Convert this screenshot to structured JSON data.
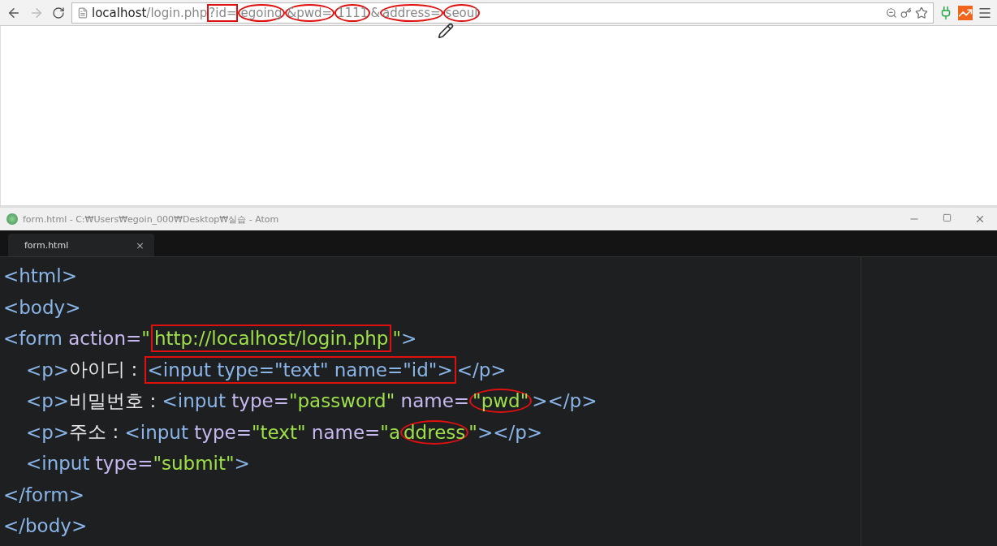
{
  "browser": {
    "url": [
      {
        "text": "localhost",
        "kind": "host"
      },
      {
        "text": "/login.php",
        "kind": "path"
      },
      {
        "text": "?id=",
        "kind": "path",
        "boxed": true
      },
      {
        "text": "egoing",
        "kind": "path",
        "circled": true
      },
      {
        "text": "&pwd=",
        "kind": "path",
        "circled": true
      },
      {
        "text": "1111",
        "kind": "path",
        "circled": true
      },
      {
        "text": "&",
        "kind": "path"
      },
      {
        "text": "address=",
        "kind": "path",
        "circled": true
      },
      {
        "text": "seoul",
        "kind": "path",
        "circled": true
      }
    ]
  },
  "editor": {
    "title": "form.html - C:₩Users₩egoin_000₩Desktop₩실습 - Atom",
    "tabs": [
      {
        "label": "form.html",
        "selected": true,
        "close": "×"
      }
    ],
    "lines": [
      {
        "indent": false,
        "tokens": [
          {
            "kind": "tag",
            "text": "<html>"
          }
        ]
      },
      {
        "indent": false,
        "tokens": [
          {
            "kind": "tag",
            "text": "<body>"
          }
        ]
      },
      {
        "indent": false,
        "tokens": [
          {
            "kind": "tag",
            "text": "<form"
          },
          {
            "kind": "attr",
            "text": " action="
          },
          {
            "kind": "string",
            "text": "\""
          },
          {
            "kind": "string",
            "text": "http://localhost/login.php",
            "boxed": true
          },
          {
            "kind": "string",
            "text": "\""
          },
          {
            "kind": "tag",
            "text": ">"
          }
        ]
      },
      {
        "indent": true,
        "tokens": [
          {
            "kind": "tag",
            "text": "<p>"
          },
          {
            "kind": "text",
            "text": "아이디 : "
          },
          {
            "kind": "tag",
            "text": "<input type=\"text\" name=\"id\">",
            "boxed": true
          },
          {
            "kind": "tag",
            "text": "</p>"
          }
        ]
      },
      {
        "indent": true,
        "tokens": [
          {
            "kind": "tag",
            "text": "<p>"
          },
          {
            "kind": "text",
            "text": "비밀번호 : "
          },
          {
            "kind": "tag",
            "text": "<input"
          },
          {
            "kind": "attr",
            "text": " type="
          },
          {
            "kind": "string",
            "text": "\"password\""
          },
          {
            "kind": "attr",
            "text": " name="
          },
          {
            "kind": "string",
            "text": "\"pwd\"",
            "circled": true
          },
          {
            "kind": "tag",
            "text": "></p>"
          }
        ]
      },
      {
        "indent": true,
        "tokens": [
          {
            "kind": "tag",
            "text": "<p>"
          },
          {
            "kind": "text",
            "text": "주소 : "
          },
          {
            "kind": "tag",
            "text": "<input"
          },
          {
            "kind": "attr",
            "text": " type="
          },
          {
            "kind": "string",
            "text": "\"text\""
          },
          {
            "kind": "attr",
            "text": " name="
          },
          {
            "kind": "string",
            "text": "\"a"
          },
          {
            "kind": "string",
            "text": "ddress",
            "circled": true
          },
          {
            "kind": "string",
            "text": "\""
          },
          {
            "kind": "tag",
            "text": "></p>"
          }
        ]
      },
      {
        "indent": true,
        "tokens": [
          {
            "kind": "tag",
            "text": "<input"
          },
          {
            "kind": "attr",
            "text": " type="
          },
          {
            "kind": "string",
            "text": "\"submit\""
          },
          {
            "kind": "tag",
            "text": ">"
          }
        ]
      },
      {
        "indent": false,
        "tokens": [
          {
            "kind": "tag",
            "text": "</form>"
          }
        ]
      },
      {
        "indent": false,
        "tokens": [
          {
            "kind": "tag",
            "text": "</body>"
          }
        ]
      }
    ]
  }
}
